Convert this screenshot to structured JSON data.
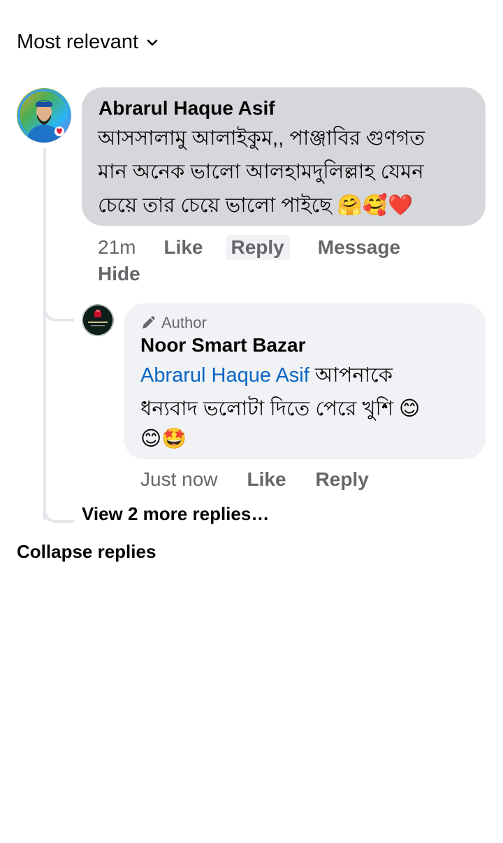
{
  "sort": {
    "label": "Most relevant"
  },
  "comment": {
    "author": "Abrarul Haque Asif",
    "text_line1": "আসসালামু আলাইকুম,, পাঞ্জাবির গুণগত",
    "text_line2": "মান অনেক ভালো আলহামদুলিল্লাহ  যেমন",
    "text_line3": "চেয়ে তার চেয়ে ভালো পাইছে 🤗🥰❤️",
    "time": "21m",
    "like_label": "Like",
    "reply_label": "Reply",
    "message_label": "Message",
    "hide_label": "Hide"
  },
  "reply": {
    "badge": "Author",
    "author": "Noor Smart Bazar",
    "mention": "Abrarul Haque Asif",
    "text_line1_rest": " আপনাকে",
    "text_line2": "ধন্যবাদ ভলোটা দিতে পেরে খুশি 😊",
    "text_line3": "😊🤩",
    "time": "Just now",
    "like_label": "Like",
    "reply_label": "Reply"
  },
  "view_more_label": "View 2 more replies…",
  "collapse_label": "Collapse replies",
  "colors": {
    "bubble_main": "#d5d7db",
    "bubble_reply": "#f0f2f5",
    "mention": "#0a66c2",
    "secondary_text": "#65676b"
  }
}
